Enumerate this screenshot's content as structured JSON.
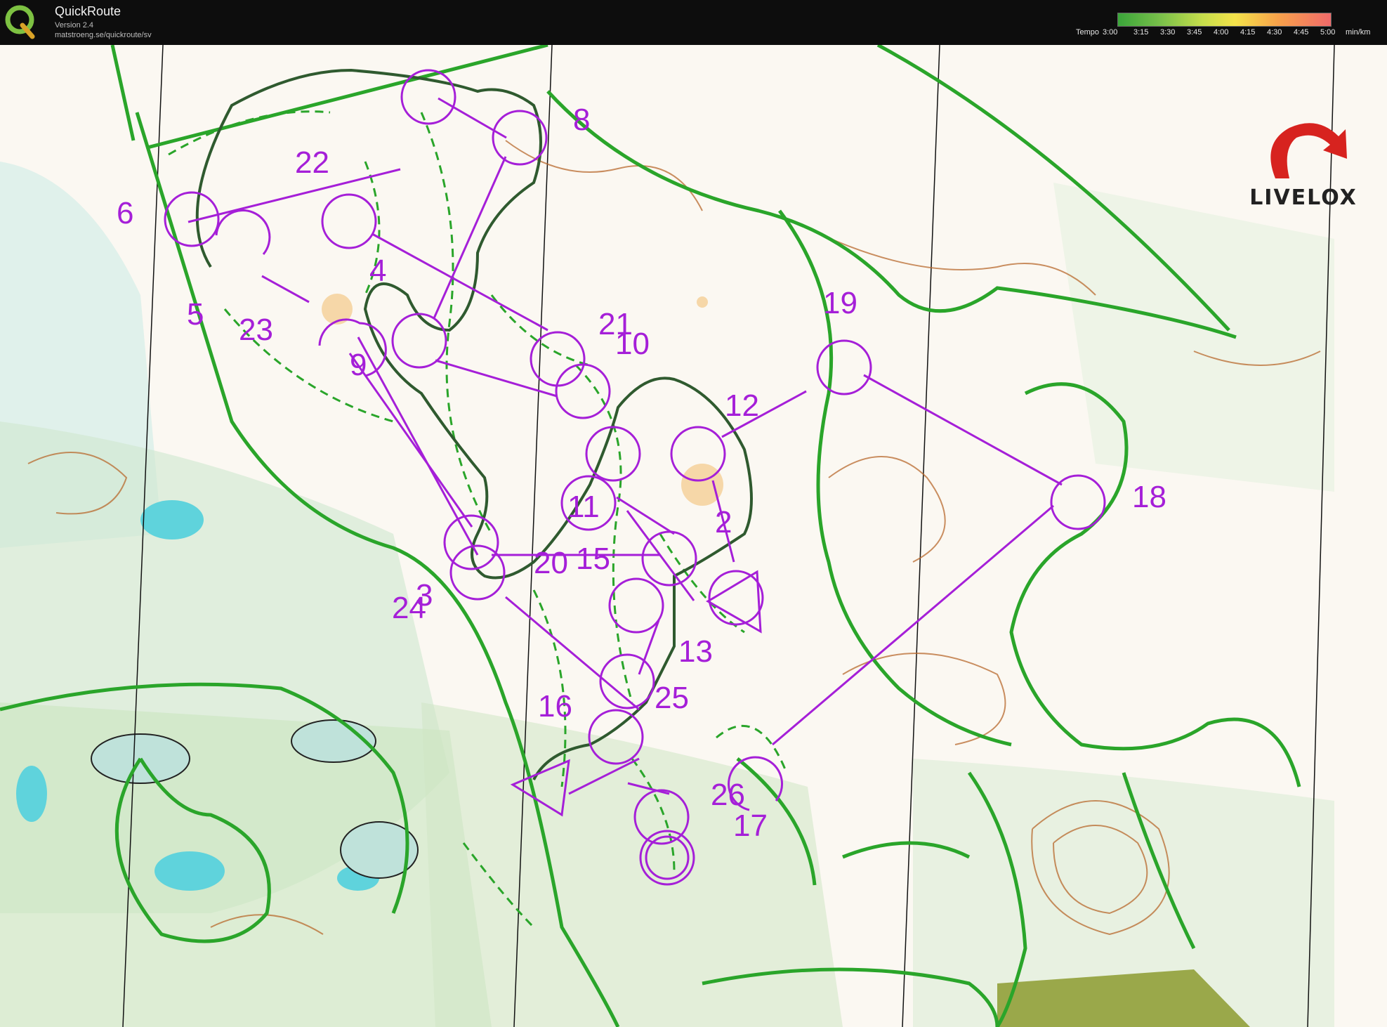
{
  "window": {
    "app_name": "QuickRoute",
    "version": "Version 2.4",
    "url": "matstroeng.se/quickroute/sv",
    "logo_letter": "Q",
    "logo_icon": "quickroute-q-icon"
  },
  "tempo_legend": {
    "label": "Tempo",
    "ticks": [
      "3:00",
      "3:15",
      "3:30",
      "3:45",
      "4:00",
      "4:15",
      "4:30",
      "4:45",
      "5:00"
    ],
    "unit": "min/km"
  },
  "branding": {
    "name": "LIVELOX",
    "accent_color": "#d7231f"
  },
  "map": {
    "route_color": "#2a4a2a",
    "course_color": "#a51fd8",
    "track_color": "#2aa52a",
    "contour_color": "#b8692e",
    "controls": [
      "22",
      "8",
      "6",
      "4",
      "5",
      "23",
      "9",
      "21",
      "10",
      "19",
      "12",
      "18",
      "11",
      "2",
      "20",
      "15",
      "24",
      "3",
      "13",
      "16",
      "25",
      "26",
      "17"
    ]
  }
}
